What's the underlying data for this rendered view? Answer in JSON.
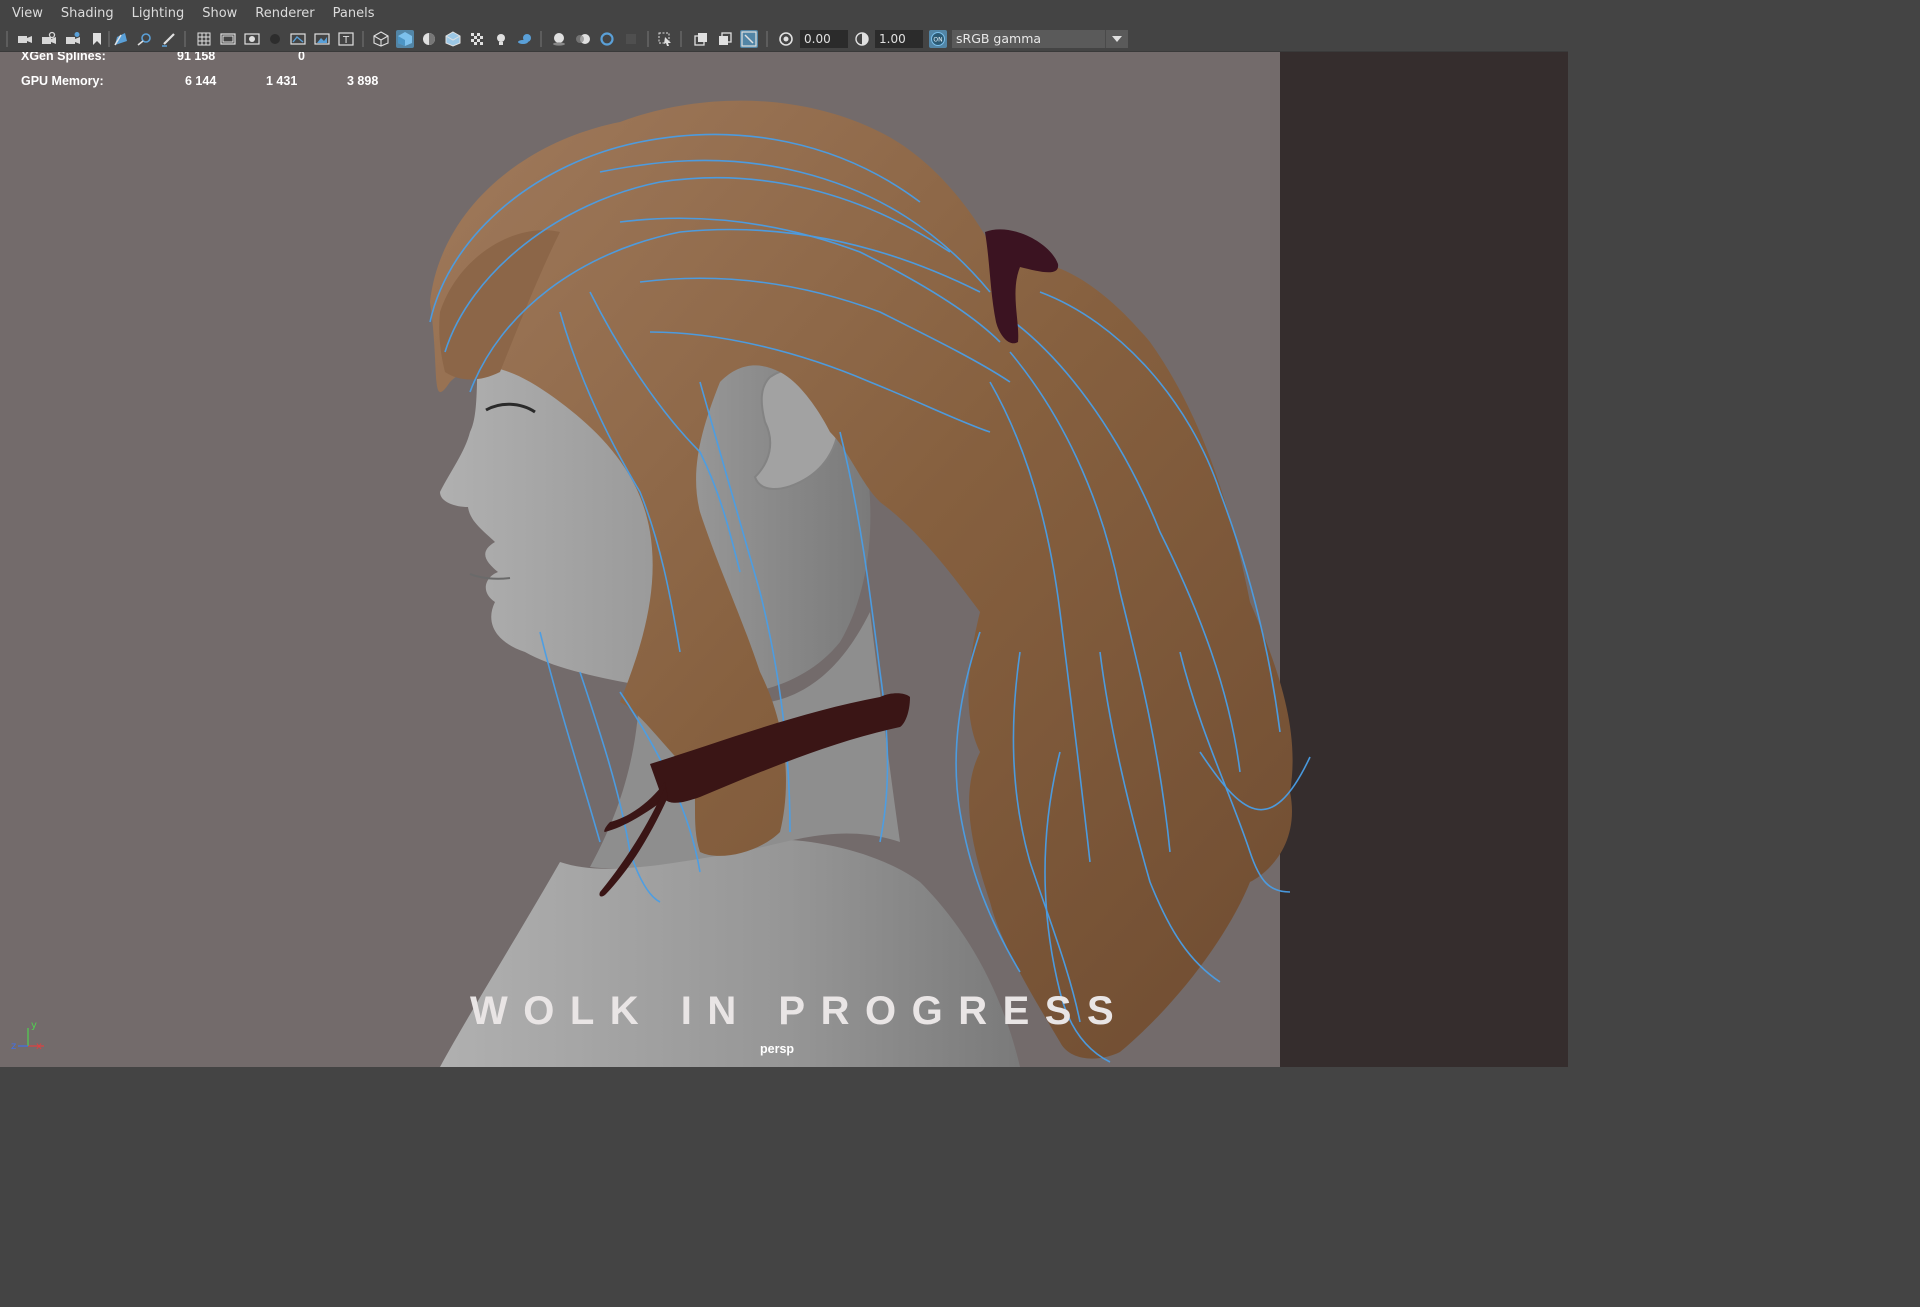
{
  "menubar": {
    "items": [
      "View",
      "Shading",
      "Lighting",
      "Show",
      "Renderer",
      "Panels"
    ]
  },
  "toolbar": {
    "icons": [
      "camera-select-icon",
      "camera-lock-icon",
      "camera-attributes-icon",
      "bookmark-icon",
      "image-plane-icon",
      "2d-pan-zoom-icon",
      "grease-pencil-icon",
      "grid-icon",
      "film-gate-icon",
      "resolution-gate-icon",
      "gate-mask-icon",
      "field-chart-icon",
      "safe-action-icon",
      "safe-title-icon",
      "wireframe-icon",
      "smooth-shade-icon",
      "default-material-icon",
      "wireframe-on-shaded-icon",
      "textured-icon",
      "use-all-lights-icon",
      "shadows-icon",
      "screen-space-ao-icon",
      "motion-blur-icon",
      "multisample-aa-icon",
      "depth-of-field-icon",
      "isolate-select-icon",
      "xray-icon",
      "xray-active-components-icon",
      "xray-joints-icon",
      "exposure-icon",
      "gamma-icon",
      "color-management-icon"
    ],
    "exposure_value": "0.00",
    "gamma_value": "1.00",
    "color_management_badge": "ON",
    "color_space": "sRGB gamma"
  },
  "hud": {
    "rows": [
      {
        "label": "XGen Splines:",
        "values": [
          "91 158",
          "0"
        ]
      },
      {
        "label": "GPU Memory:",
        "values": [
          "6 144",
          "1 431",
          "3 898"
        ]
      }
    ]
  },
  "overlay": {
    "watermark": "WOLK IN PROGRESS",
    "camera": "persp"
  },
  "axis": {
    "x": "x",
    "y": "y",
    "z": "z"
  },
  "colors": {
    "viewport_bg": "#736b6b",
    "hair": "#8a6448",
    "guide_curves": "#4a9ee6",
    "skin": "#9b9b9b",
    "ribbon": "#3a1515",
    "active_icon": "#5285a6"
  }
}
